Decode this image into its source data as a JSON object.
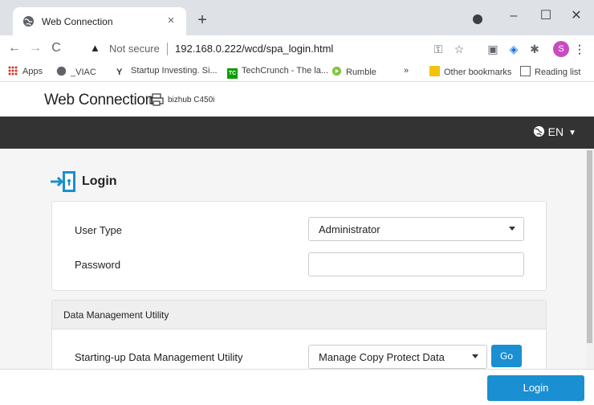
{
  "browser": {
    "tab_title": "Web Connection",
    "tab_close": "×",
    "new_tab": "+",
    "window_controls": {
      "minimize": "–",
      "maximize": "☐",
      "close": "✕"
    },
    "nav": {
      "back": "←",
      "forward": "→",
      "reload": "C"
    },
    "address": {
      "security_label": "Not secure",
      "url": "192.168.0.222/wcd/spa_login.html"
    },
    "profile_initial": "S",
    "toolbar_icons": [
      "key-icon",
      "star-icon",
      "extension-icon",
      "shield-extension-icon",
      "puzzle-icon",
      "menu-icon"
    ]
  },
  "bookmarks": {
    "items": [
      {
        "label": "Apps",
        "icon": "apps-grid-icon"
      },
      {
        "label": "_VIAC",
        "icon": "globe-icon"
      },
      {
        "label": "Startup Investing. Si...",
        "icon": "yc-icon"
      },
      {
        "label": "TechCrunch - The la...",
        "icon": "techcrunch-icon"
      },
      {
        "label": "Rumble",
        "icon": "rumble-icon"
      }
    ],
    "overflow": "»",
    "other_bookmarks": "Other bookmarks",
    "reading_list": "Reading list"
  },
  "app": {
    "brand": "Web Connection",
    "model": "bizhub C450i",
    "language": "EN",
    "login_title": "Login",
    "user_type_label": "User Type",
    "user_type_value": "Administrator",
    "password_label": "Password",
    "password_value": "",
    "dmu_section_title": "Data Management Utility",
    "dmu_label": "Starting-up Data Management Utility",
    "dmu_select_value": "Manage Copy Protect Data",
    "go_label": "Go",
    "login_button": "Login"
  },
  "colors": {
    "accent": "#1a8fd1",
    "header_dark": "#333333",
    "tabstrip": "#dee1e6",
    "avatar": "#c94bc1"
  }
}
